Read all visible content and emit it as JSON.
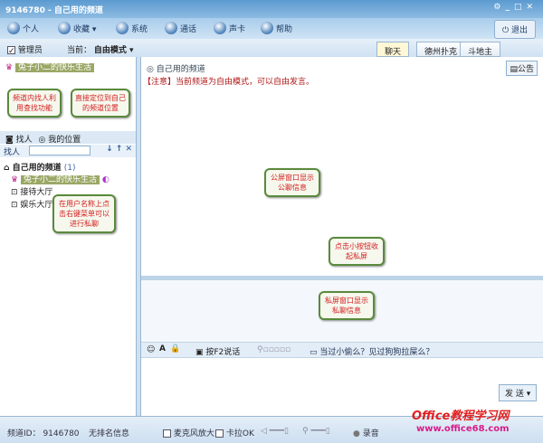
{
  "window": {
    "title": "9146780 - 自己用的频道",
    "controls": [
      "settings",
      "minimize",
      "maximize",
      "close"
    ]
  },
  "toolbar": {
    "items": [
      "个人",
      "收藏 ▾",
      "系统",
      "通话",
      "声卡",
      "帮助"
    ],
    "exit": "退出"
  },
  "row2": {
    "admin": "管理员",
    "current_label": "当前：",
    "mode": "自由模式 ▾"
  },
  "tabs": [
    "聊天",
    "德州扑克",
    "斗地主"
  ],
  "left": {
    "top_user": "兔子小二的快乐生活",
    "find_tab": "找人",
    "location_tab": "我的位置",
    "search_label": "找人",
    "search_value": "",
    "channel": "自己用的频道",
    "channel_count": "(1)",
    "user": "兔子小二的快乐生活",
    "rooms": [
      "接待大厅",
      "娱乐大厅"
    ]
  },
  "chat": {
    "channel": "自己用的频道",
    "notice_button": "公告",
    "notice": "【注意】当前频道为自由模式，可以自由发言。"
  },
  "input_bar": {
    "ptt": "按F2说话",
    "tip": "当过小偷么？见过狗狗拉屎么？",
    "send": "发 送"
  },
  "callouts": [
    "频道内找人利用查找功能",
    "直接定位到自己的频道位置",
    "在用户名称上点击右键菜单可以进行私聊",
    "公屏窗口显示公聊信息",
    "点击小按钮收起私屏",
    "私屏窗口显示私聊信息"
  ],
  "status": {
    "channel_id": "频道ID： 9146780",
    "rank": "无排名信息",
    "mic_boost": "麦克风放大",
    "karaoke": "卡拉OK",
    "record": "录音"
  },
  "watermark": {
    "text": "Office教程学习网",
    "url": "www.office68.com"
  }
}
